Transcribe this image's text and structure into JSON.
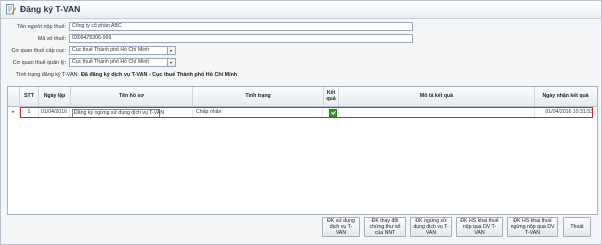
{
  "window": {
    "title": "Đăng ký T-VAN"
  },
  "form": {
    "taxpayer_name_label": "Tên người nộp thuế:",
    "taxpayer_name_value": "Công ty cổ phần ABC",
    "tax_code_label": "Mã số thuế:",
    "tax_code_value": "0309478306-999",
    "tax_authority_issuing_label": "Cơ quan thuế cấp cục:",
    "tax_authority_issuing_value": "Cục thuế Thành phố Hồ Chí Minh",
    "tax_authority_managing_label": "Cơ quan thuế quản lý:",
    "tax_authority_managing_value": "Cục thuế Thành phố Hồ Chí Minh",
    "status_label": "Tình trạng đăng ký T-VAN:",
    "status_value": "Đã đăng ký dịch vụ T-VAN - Cục thuế Thành phố Hồ Chí Minh"
  },
  "grid": {
    "headers": {
      "stt": "STT",
      "date": "Ngày lập",
      "name": "Tên hồ sơ",
      "status": "Tình trạng",
      "result": "Kết quả",
      "result_desc": "Mô tả kết quả",
      "received": "Ngày nhận kết quả"
    },
    "rows": [
      {
        "stt": "1",
        "date": "01/04/2016",
        "name": "Đăng ký ngừng sử dụng dịch vụ T-VAN",
        "status": "Chấp nhận",
        "result_desc": "",
        "received": "01/04/2016 10:31:53"
      }
    ]
  },
  "buttons": {
    "register": "ĐK sử dụng dịch vụ T-VAN",
    "change_info": "ĐK thay đổi chứng thư số của NNT",
    "stop": "ĐK ngừng sử dụng dịch vụ T-VAN",
    "hs_file": "ĐK HS khai thuế nộp qua DV T-VAN",
    "hs_stop": "ĐK HS khai thuế ngừng nộp qua DV T-VAN",
    "exit": "Thoát"
  },
  "colors": {
    "selection_border": "#e02020",
    "result_ok": "#3a9a2a"
  },
  "icons": {
    "title_icon": "edit-document-icon",
    "row_indicator": "row-pointer-icon",
    "result_icon": "check-icon"
  }
}
